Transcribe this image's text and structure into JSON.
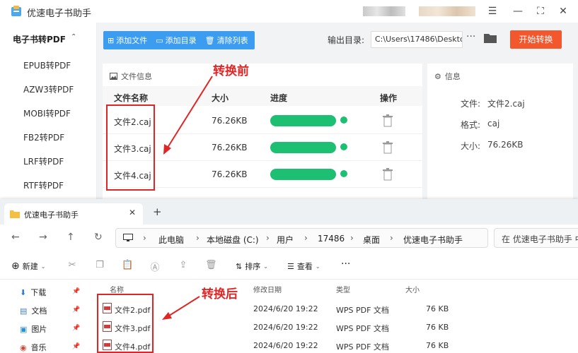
{
  "app": {
    "title": "优速电子书助手",
    "window_controls": [
      "☰",
      "—",
      "⛶",
      "✕"
    ],
    "sidebar": {
      "section": "电子书转PDF",
      "caret": "⌃",
      "items": [
        "EPUB转PDF",
        "AZW3转PDF",
        "MOBI转PDF",
        "FB2转PDF",
        "LRF转PDF",
        "RTF转PDF"
      ]
    },
    "toolbar": {
      "add_file": "添加文件",
      "add_folder": "添加目录",
      "clear_list": "清除列表",
      "output_label": "输出目录:",
      "output_path": "C:\\Users\\17486\\Deskto",
      "more": "···",
      "start": "开始转换"
    },
    "file_panel": {
      "title": "文件信息",
      "columns": [
        "文件名称",
        "大小",
        "进度",
        "操作"
      ],
      "rows": [
        {
          "name": "文件2.caj",
          "size": "76.26KB",
          "progress": 1.0
        },
        {
          "name": "文件3.caj",
          "size": "76.26KB",
          "progress": 1.0
        },
        {
          "name": "文件4.caj",
          "size": "76.26KB",
          "progress": 1.0
        }
      ]
    },
    "info_panel": {
      "title": "信息",
      "fields": [
        {
          "k": "文件:",
          "v": "文件2.caj"
        },
        {
          "k": "格式:",
          "v": "caj"
        },
        {
          "k": "大小:",
          "v": "76.26KB"
        }
      ]
    }
  },
  "annotations": {
    "before": "转换前",
    "after": "转换后"
  },
  "explorer": {
    "tab_title": "优速电子书助手",
    "tab_close": "✕",
    "tab_add": "+",
    "nav": {
      "back": "←",
      "forward": "→",
      "up": "↑",
      "refresh": "↻"
    },
    "breadcrumbs": [
      "此电脑",
      "本地磁盘 (C:)",
      "用户",
      "17486",
      "桌面",
      "优速电子书助手"
    ],
    "search_placeholder": "在 优速电子书助手 中",
    "commands": {
      "new": "新建",
      "sort": "排序",
      "view": "查看",
      "more": "···"
    },
    "nav_pane": [
      "下载",
      "文档",
      "图片",
      "音乐"
    ],
    "columns": [
      "名称",
      "修改日期",
      "类型",
      "大小"
    ],
    "files": [
      {
        "name": "文件2.pdf",
        "date": "2024/6/20 19:22",
        "type": "WPS PDF 文档",
        "size": "76 KB"
      },
      {
        "name": "文件3.pdf",
        "date": "2024/6/20 19:22",
        "type": "WPS PDF 文档",
        "size": "76 KB"
      },
      {
        "name": "文件4.pdf",
        "date": "2024/6/20 19:22",
        "type": "WPS PDF 文档",
        "size": "76 KB"
      }
    ]
  },
  "colors": {
    "accent_blue": "#3b9cf0",
    "start_orange": "#f2572e",
    "progress_green": "#1dbf73",
    "annotation_red": "#e02525"
  }
}
